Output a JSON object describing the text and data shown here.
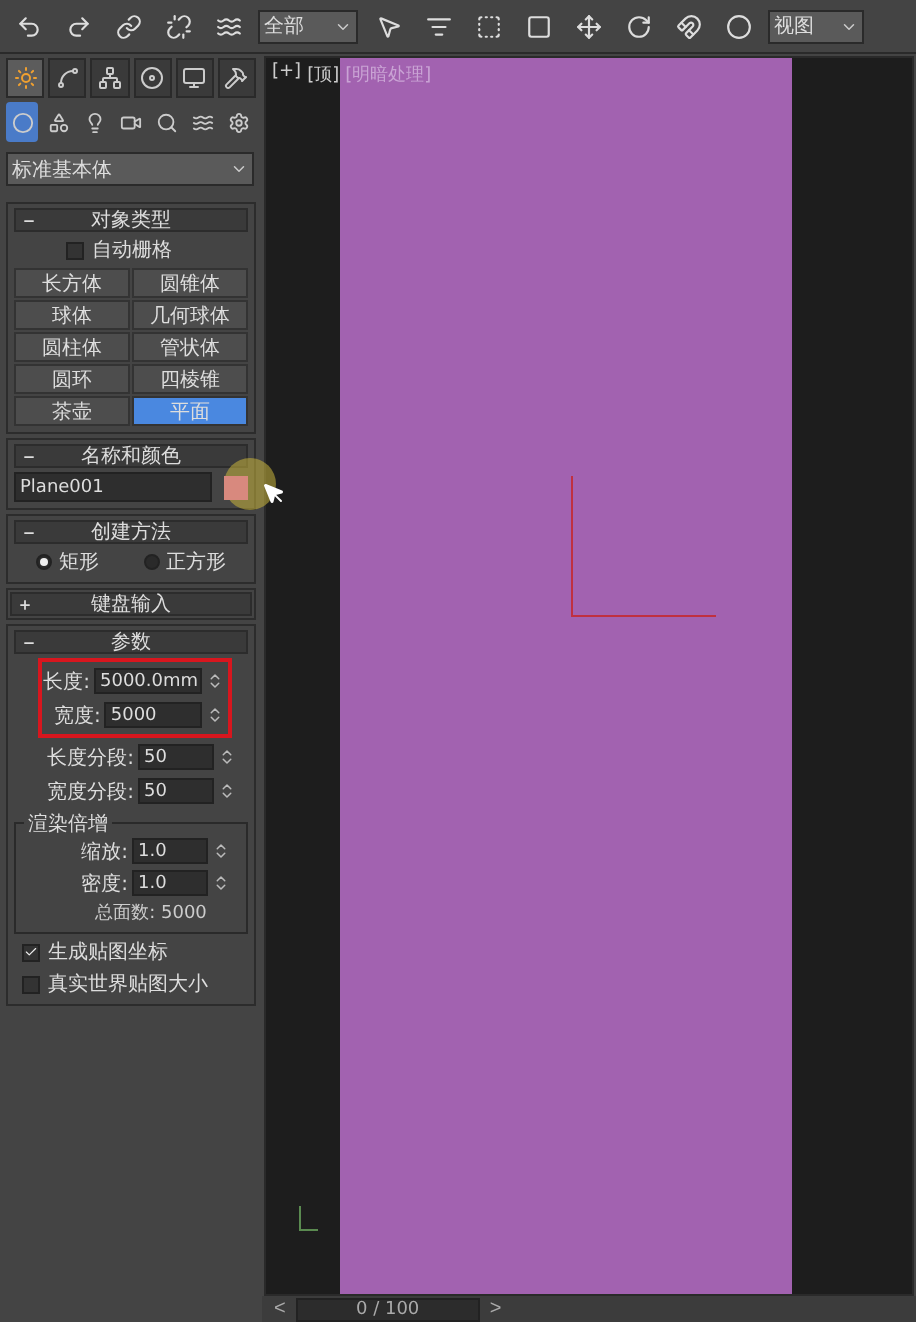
{
  "toolbar": {
    "selection_filter": "全部",
    "coordinate_system": "视图"
  },
  "command_panel": {
    "tabs": [
      {
        "selected": true
      },
      {
        "selected": false
      },
      {
        "selected": false
      },
      {
        "selected": false
      },
      {
        "selected": false
      },
      {
        "selected": false
      }
    ],
    "subtabs": [
      {
        "selected": true
      },
      {
        "selected": false
      },
      {
        "selected": false
      },
      {
        "selected": false
      },
      {
        "selected": false
      },
      {
        "selected": false
      },
      {
        "selected": false
      }
    ],
    "category": "标准基本体",
    "object_type": {
      "title": "对象类型",
      "expanded": true,
      "autogrid": {
        "label": "自动栅格",
        "checked": false
      },
      "buttons": [
        {
          "label": "长方体",
          "selected": false
        },
        {
          "label": "圆锥体",
          "selected": false
        },
        {
          "label": "球体",
          "selected": false
        },
        {
          "label": "几何球体",
          "selected": false
        },
        {
          "label": "圆柱体",
          "selected": false
        },
        {
          "label": "管状体",
          "selected": false
        },
        {
          "label": "圆环",
          "selected": false
        },
        {
          "label": "四棱锥",
          "selected": false
        },
        {
          "label": "茶壶",
          "selected": false
        },
        {
          "label": "平面",
          "selected": true
        }
      ]
    },
    "name_color": {
      "title": "名称和颜色",
      "expanded": true,
      "name": "Plane001",
      "color": "#d8897e"
    },
    "creation_method": {
      "title": "创建方法",
      "expanded": true,
      "options": [
        {
          "label": "矩形",
          "selected": true
        },
        {
          "label": "正方形",
          "selected": false
        }
      ]
    },
    "keyboard_entry": {
      "title": "键盘输入",
      "expanded": false
    },
    "parameters": {
      "title": "参数",
      "expanded": true,
      "size_fields": [
        {
          "label": "长度:",
          "value": "5000.0mm"
        },
        {
          "label": "宽度:",
          "value": "5000"
        }
      ],
      "segment_fields": [
        {
          "label": "长度分段:",
          "value": "50"
        },
        {
          "label": "宽度分段:",
          "value": "50"
        }
      ],
      "render_multipliers": {
        "title": "渲染倍增",
        "fields": [
          {
            "label": "缩放:",
            "value": "1.0"
          },
          {
            "label": "密度:",
            "value": "1.0"
          }
        ],
        "total": "总面数: 5000"
      },
      "checkboxes": [
        {
          "label": "生成贴图坐标",
          "checked": true
        },
        {
          "label": "真实世界贴图大小",
          "checked": false
        }
      ]
    }
  },
  "viewport": {
    "labels": [
      "[+]",
      "[顶]",
      "[明暗处理]"
    ]
  },
  "timeline": {
    "prev": "<",
    "position": "0 / 100",
    "next": ">"
  }
}
